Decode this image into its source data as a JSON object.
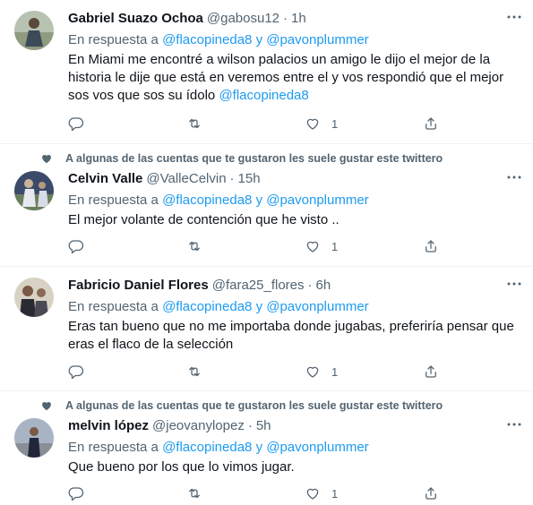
{
  "social_context": "A algunas de las cuentas que te gustaron les suele gustar este twittero",
  "reply_prefix": "En respuesta a",
  "reply_and": "y",
  "tweets": [
    {
      "name": "Gabriel Suazo Ochoa",
      "handle": "@gabosu12",
      "separator": "·",
      "time": "1h",
      "reply_to_1": "@flacopineda8",
      "reply_to_2": "@pavonplummer",
      "text": "En Miami me encontré a wilson palacios un amigo le dijo el mejor de la historia le dije que está en veremos entre el y vos respondió que el mejor sos vos que sos su ídolo",
      "mention": "@flacopineda8",
      "likes": "1"
    },
    {
      "name": "Celvin Valle",
      "handle": "@ValleCelvin",
      "separator": "·",
      "time": "15h",
      "reply_to_1": "@flacopineda8",
      "reply_to_2": "@pavonplummer",
      "text": "El mejor volante de contención que he visto ..",
      "likes": "1"
    },
    {
      "name": "Fabricio Daniel Flores",
      "handle": "@fara25_flores",
      "separator": "·",
      "time": "6h",
      "reply_to_1": "@flacopineda8",
      "reply_to_2": "@pavonplummer",
      "text": "Eras tan bueno que no me importaba donde jugabas, preferiría pensar que eras el flaco de la selección",
      "likes": "1"
    },
    {
      "name": "melvin lópez",
      "handle": "@jeovanylopez",
      "separator": "·",
      "time": "5h",
      "reply_to_1": "@flacopineda8",
      "reply_to_2": "@pavonplummer",
      "text": "Que bueno por los que lo vimos jugar.",
      "likes": "1"
    }
  ],
  "icons": [
    "heart-icon",
    "more-icon",
    "reply-icon",
    "retweet-icon",
    "like-icon",
    "share-icon"
  ],
  "colors": {
    "link": "#1d9bf0",
    "secondary": "#536471",
    "text": "#0f1419",
    "divider": "#eff3f4"
  }
}
